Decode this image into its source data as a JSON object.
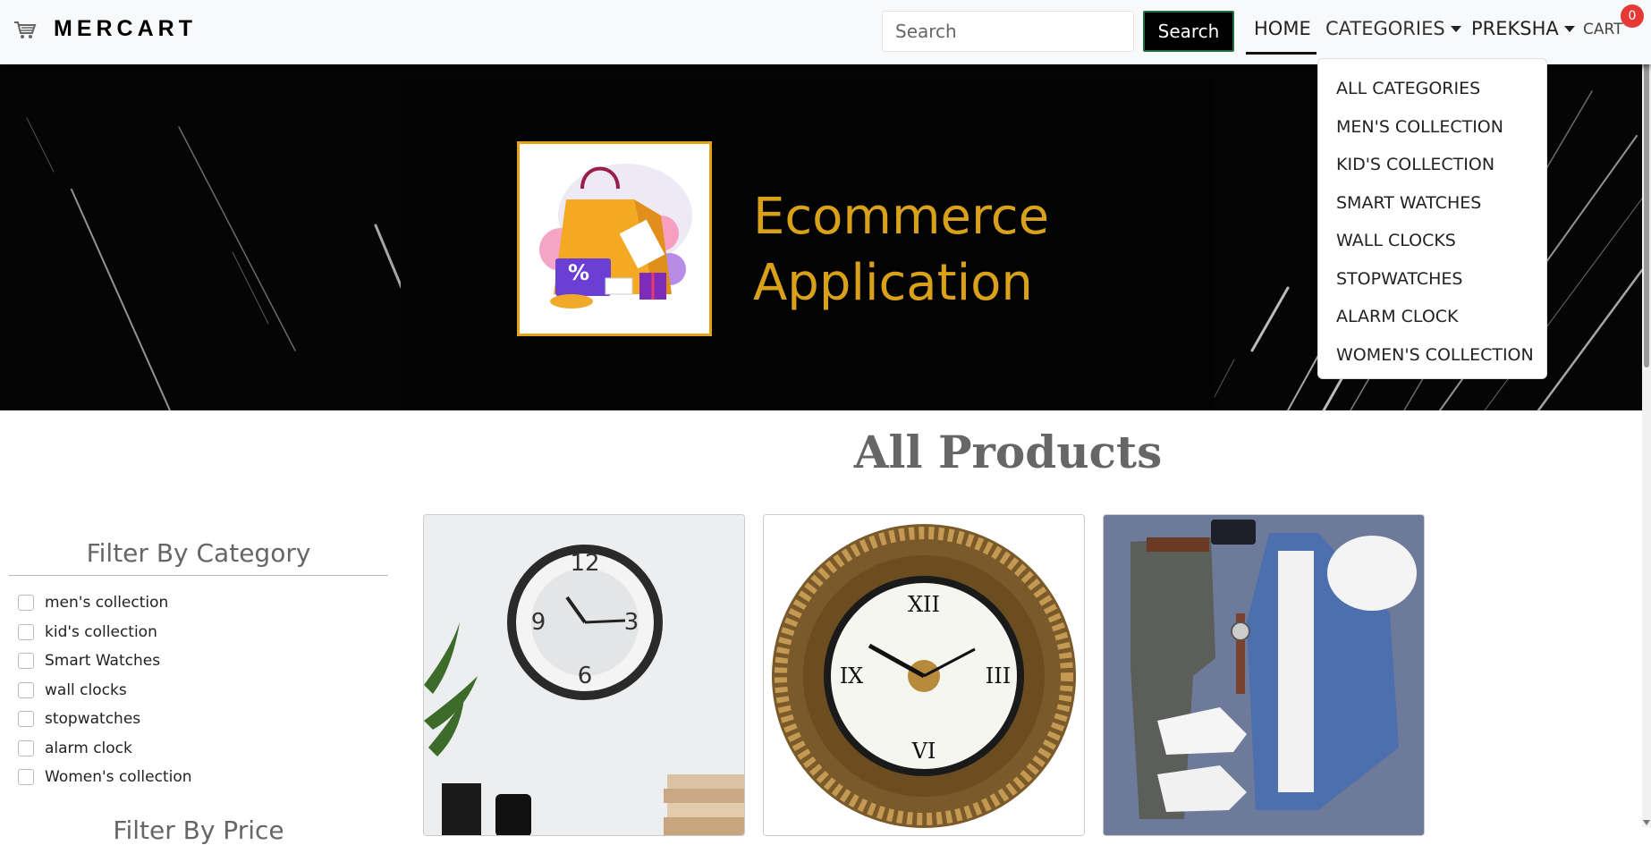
{
  "navbar": {
    "brand": "MERCART",
    "search_placeholder": "Search",
    "search_button": "Search",
    "home": "HOME",
    "categories": "CATEGORIES",
    "user": "PREKSHA",
    "cart": "CART",
    "cart_count": "0"
  },
  "dropdown": {
    "items": [
      "ALL CATEGORIES",
      "MEN'S COLLECTION",
      "KID'S COLLECTION",
      "SMART WATCHES",
      "WALL CLOCKS",
      "STOPWATCHES",
      "ALARM CLOCK",
      "WOMEN'S COLLECTION"
    ]
  },
  "banner": {
    "line1": "Ecommerce",
    "line2": "Application",
    "logo_badge": "%"
  },
  "main": {
    "heading": "All Products"
  },
  "filters": {
    "category_title": "Filter By Category",
    "categories": [
      "men's collection",
      "kid's collection",
      "Smart Watches",
      "wall clocks",
      "stopwatches",
      "alarm clock",
      "Women's collection"
    ],
    "price_title": "Filter By Price"
  },
  "products": {
    "cards": [
      {
        "image": "wall-clock-world-map"
      },
      {
        "image": "ornate-brass-wall-clock"
      },
      {
        "image": "mens-outfit-flatlay"
      }
    ]
  },
  "colors": {
    "accent": "#d9a11a",
    "badge": "#e53935",
    "navbar_bg": "#f8f9fa"
  }
}
